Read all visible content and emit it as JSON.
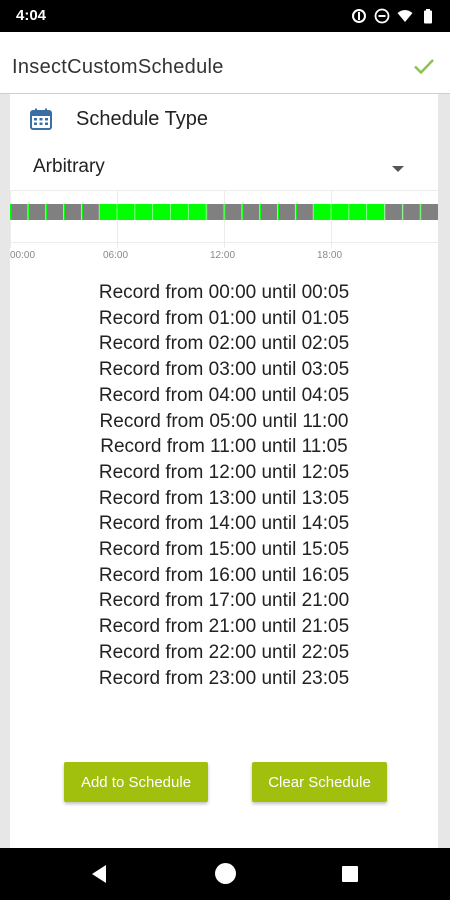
{
  "status_bar": {
    "time": "4:04",
    "icons": [
      "data-saver-icon",
      "do-not-disturb-icon",
      "wifi-icon",
      "battery-icon"
    ]
  },
  "app_bar": {
    "title": "InsectCustomSchedule",
    "confirm_icon": "check-icon",
    "accent_color": "#8bc34a"
  },
  "schedule_type": {
    "icon": "calendar-icon",
    "label": "Schedule Type",
    "selected": "Arbitrary"
  },
  "timeline": {
    "tick_labels": [
      "00:00",
      "06:00",
      "12:00",
      "18:00"
    ],
    "hours_total": 24,
    "active_color": "#00ff00",
    "inactive_color": "#808080"
  },
  "records": [
    {
      "from": "00:00",
      "until": "00:05",
      "text": "Record from 00:00 until 00:05"
    },
    {
      "from": "01:00",
      "until": "01:05",
      "text": "Record from 01:00 until 01:05"
    },
    {
      "from": "02:00",
      "until": "02:05",
      "text": "Record from 02:00 until 02:05"
    },
    {
      "from": "03:00",
      "until": "03:05",
      "text": "Record from 03:00 until 03:05"
    },
    {
      "from": "04:00",
      "until": "04:05",
      "text": "Record from 04:00 until 04:05"
    },
    {
      "from": "05:00",
      "until": "11:00",
      "text": "Record from 05:00 until 11:00"
    },
    {
      "from": "11:00",
      "until": "11:05",
      "text": "Record from 11:00 until 11:05"
    },
    {
      "from": "12:00",
      "until": "12:05",
      "text": "Record from 12:00 until 12:05"
    },
    {
      "from": "13:00",
      "until": "13:05",
      "text": "Record from 13:00 until 13:05"
    },
    {
      "from": "14:00",
      "until": "14:05",
      "text": "Record from 14:00 until 14:05"
    },
    {
      "from": "15:00",
      "until": "15:05",
      "text": "Record from 15:00 until 15:05"
    },
    {
      "from": "16:00",
      "until": "16:05",
      "text": "Record from 16:00 until 16:05"
    },
    {
      "from": "17:00",
      "until": "21:00",
      "text": "Record from 17:00 until 21:00"
    },
    {
      "from": "21:00",
      "until": "21:05",
      "text": "Record from 21:00 until 21:05"
    },
    {
      "from": "22:00",
      "until": "22:05",
      "text": "Record from 22:00 until 22:05"
    },
    {
      "from": "23:00",
      "until": "23:05",
      "text": "Record from 23:00 until 23:05"
    }
  ],
  "buttons": {
    "add_label": "Add to Schedule",
    "clear_label": "Clear Schedule",
    "color": "#a1c00e"
  },
  "nav_bar": {
    "back_icon": "back-triangle-icon",
    "home_icon": "home-circle-icon",
    "recents_icon": "recents-square-icon"
  }
}
